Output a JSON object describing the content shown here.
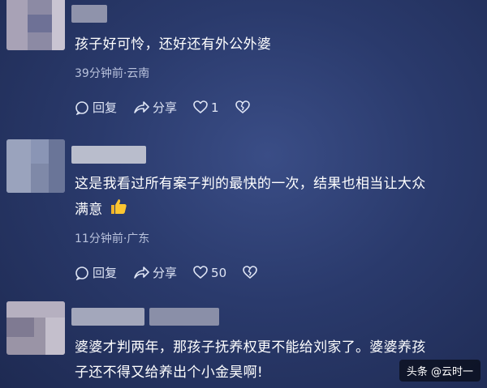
{
  "comments": [
    {
      "text": "孩子好可怜，还好还有外公外婆",
      "meta": "39分钟前·云南",
      "reply_label": "回复",
      "share_label": "分享",
      "like_count": "1"
    },
    {
      "text_line1": "这是我看过所有案子判的最快的一次，结果也相当让大众",
      "text_line2": "满意",
      "emoji_name": "thumbs-up-icon",
      "meta": "11分钟前·广东",
      "reply_label": "回复",
      "share_label": "分享",
      "like_count": "50"
    },
    {
      "text_line1": "婆婆才判两年，那孩子抚养权更不能给刘家了。婆婆养孩",
      "text_line2": "子还不得又给养出个小金昊啊!"
    }
  ],
  "watermark": "头条 @云时一",
  "icons": {
    "reply": "comment-bubble-icon",
    "share": "share-arrow-icon",
    "like": "heart-icon",
    "dislike": "broken-heart-icon"
  },
  "colors": {
    "background": "#2a3a6c",
    "text": "#ffffff",
    "meta": "#b9c2dc"
  }
}
